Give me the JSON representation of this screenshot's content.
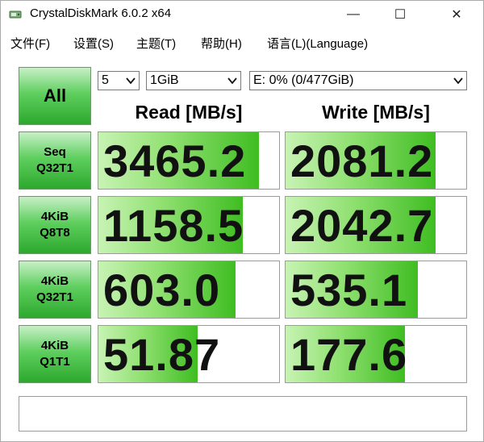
{
  "window": {
    "title": "CrystalDiskMark 6.0.2 x64",
    "minimize_glyph": "—",
    "maximize_glyph": "☐",
    "close_glyph": "✕"
  },
  "menu": [
    {
      "label": "文件(F)"
    },
    {
      "label": "设置(S)"
    },
    {
      "label": "主题(T)"
    },
    {
      "label": "帮助(H)"
    },
    {
      "label": "语言(L)(Language)"
    }
  ],
  "controls": {
    "all_label": "All",
    "count": "5",
    "size": "1GiB",
    "drive": "E: 0% (0/477GiB)"
  },
  "headers": {
    "read": "Read [MB/s]",
    "write": "Write [MB/s]"
  },
  "rows": [
    {
      "label_line1": "Seq",
      "label_line2": "Q32T1",
      "read": "3465.2",
      "write": "2081.2",
      "read_fill": 0.89,
      "write_fill": 0.83
    },
    {
      "label_line1": "4KiB",
      "label_line2": "Q8T8",
      "read": "1158.5",
      "write": "2042.7",
      "read_fill": 0.8,
      "write_fill": 0.83
    },
    {
      "label_line1": "4KiB",
      "label_line2": "Q32T1",
      "read": "603.0",
      "write": "535.1",
      "read_fill": 0.76,
      "write_fill": 0.73
    },
    {
      "label_line1": "4KiB",
      "label_line2": "Q1T1",
      "read": "51.87",
      "write": "177.6",
      "read_fill": 0.55,
      "write_fill": 0.66
    }
  ],
  "status_text": "",
  "colors": {
    "button_green": "#2da82d",
    "bar_green": "#3fbd22",
    "bar_light": "#c8f3b4"
  },
  "icons": {
    "app": "disk-icon",
    "dropdown": "chevron-down-icon"
  }
}
